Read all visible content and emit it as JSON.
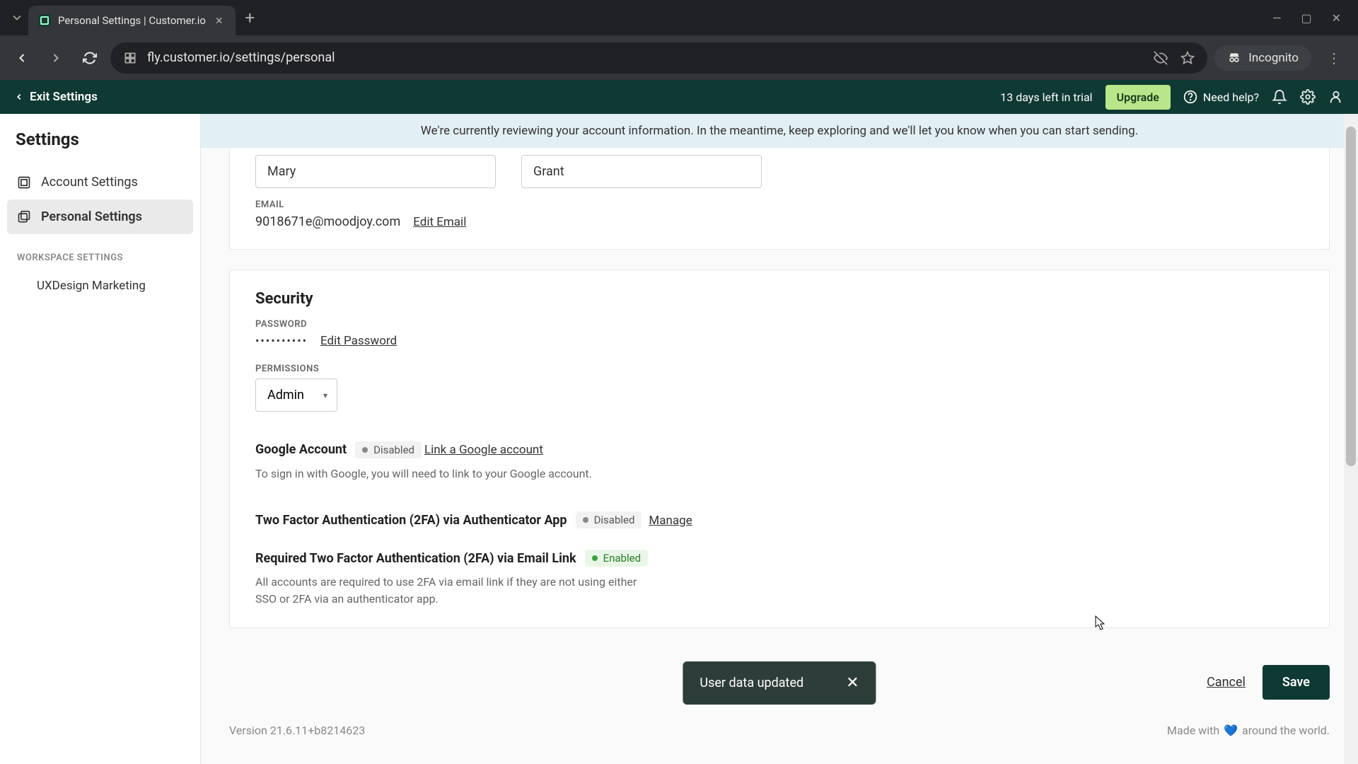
{
  "browser": {
    "tab_title": "Personal Settings | Customer.io",
    "url": "fly.customer.io/settings/personal",
    "incognito_label": "Incognito"
  },
  "topbar": {
    "exit_label": "Exit Settings",
    "trial_text": "13 days left in trial",
    "upgrade_label": "Upgrade",
    "help_label": "Need help?"
  },
  "banner": {
    "text": "We're currently reviewing your account information. In the meantime, keep exploring and we'll let you know when you can start sending."
  },
  "sidebar": {
    "title": "Settings",
    "items": [
      {
        "label": "Account Settings"
      },
      {
        "label": "Personal Settings"
      }
    ],
    "section_label": "WORKSPACE SETTINGS",
    "workspace": "UXDesign Marketing"
  },
  "profile": {
    "first_name": "Mary",
    "last_name": "Grant",
    "email_label": "EMAIL",
    "email": "9018671e@moodjoy.com",
    "edit_email": "Edit Email"
  },
  "security": {
    "title": "Security",
    "password_label": "PASSWORD",
    "password_masked": "••••••••••",
    "edit_password": "Edit Password",
    "permissions_label": "PERMISSIONS",
    "permissions_value": "Admin",
    "google": {
      "title": "Google Account",
      "status": "Disabled",
      "link_text": "Link a Google account",
      "help_text": "To sign in with Google, you will need to link to your Google account."
    },
    "tfa_app": {
      "title": "Two Factor Authentication (2FA) via Authenticator App",
      "status": "Disabled",
      "manage": "Manage"
    },
    "tfa_email": {
      "title": "Required Two Factor Authentication (2FA) via Email Link",
      "status": "Enabled",
      "help_text": "All accounts are required to use 2FA via email link if they are not using either SSO or 2FA via an authenticator app."
    }
  },
  "actions": {
    "cancel": "Cancel",
    "save": "Save"
  },
  "toast": {
    "text": "User data updated"
  },
  "footer": {
    "version": "Version 21.6.11+b8214623",
    "made_with_prefix": "Made with",
    "made_with_suffix": "around the world."
  }
}
